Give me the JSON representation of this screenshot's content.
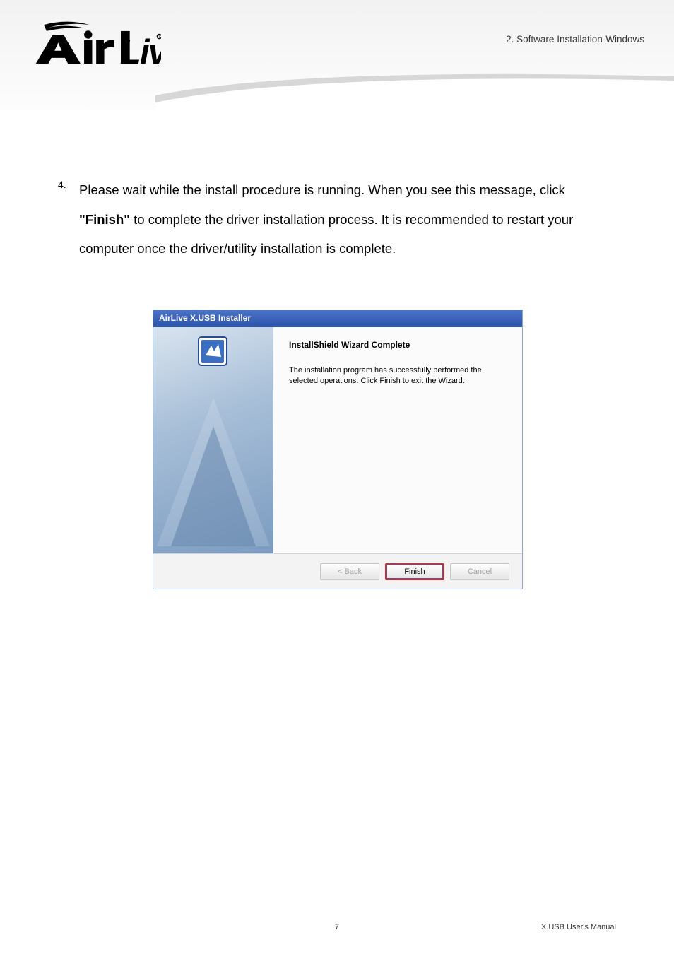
{
  "header": {
    "chapter": "2. Software  Installation-Windows",
    "logo_alt": "Air Live"
  },
  "step": {
    "num": "4.",
    "part1": "Please wait while the install procedure is running. When you see this message, click ",
    "bold": "\"Finish\"",
    "part2": " to complete the driver installation process. It is recommended to restart your computer once the driver/utility installation is complete."
  },
  "installer": {
    "title": "AirLive X.USB Installer",
    "wizard_heading": "InstallShield Wizard Complete",
    "wizard_text": "The installation program has successfully performed the selected operations.  Click Finish to exit the Wizard.",
    "buttons": {
      "back": "< Back",
      "finish": "Finish",
      "cancel": "Cancel"
    }
  },
  "footer": {
    "page": "7",
    "manual": "X.USB User's Manual"
  }
}
